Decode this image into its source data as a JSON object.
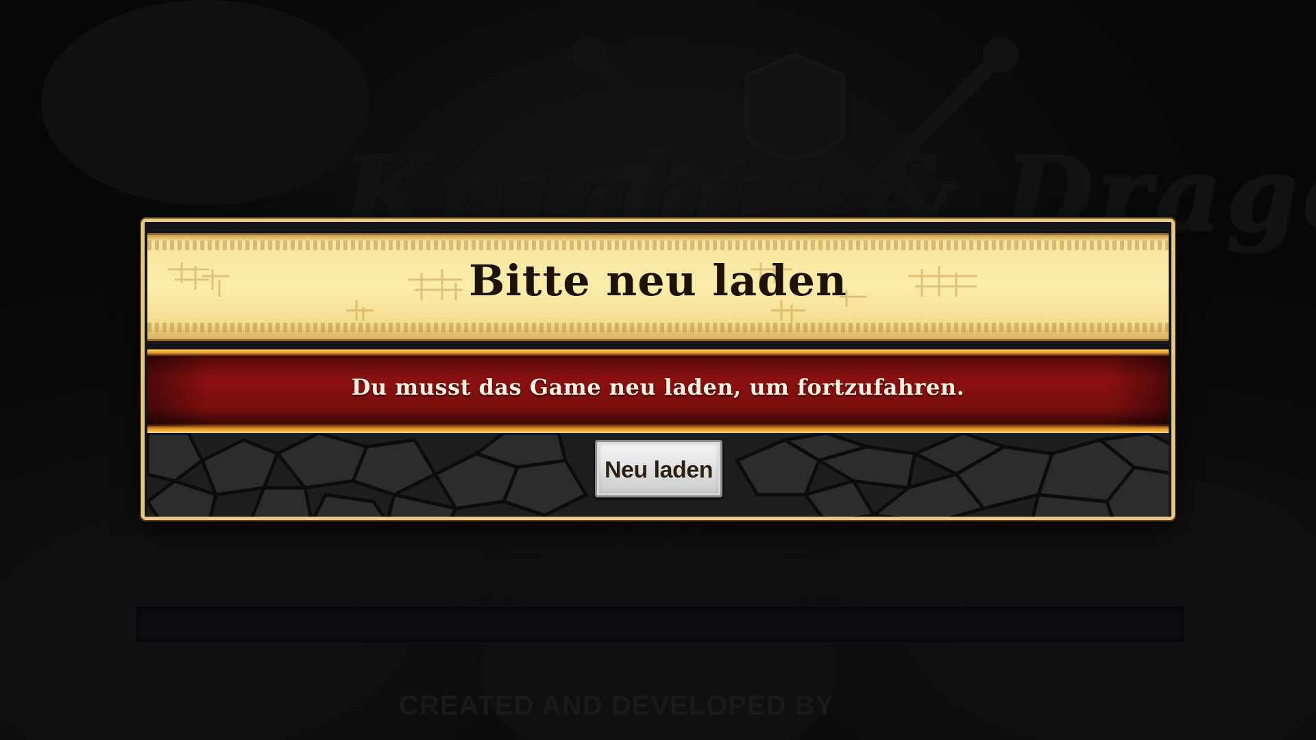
{
  "background": {
    "logo_text": "Knights & Dragons",
    "credit_text": "CREATED AND DEVELOPED BY"
  },
  "dialog": {
    "title": "Bitte neu laden",
    "message": "Du musst das Game neu laden, um fortzufahren.",
    "button_label": "Neu laden"
  },
  "colors": {
    "frame_gold": "#e8c98a",
    "title_band": "#fbecaa",
    "message_band": "#8b1111",
    "button": "#e4e4e4"
  }
}
